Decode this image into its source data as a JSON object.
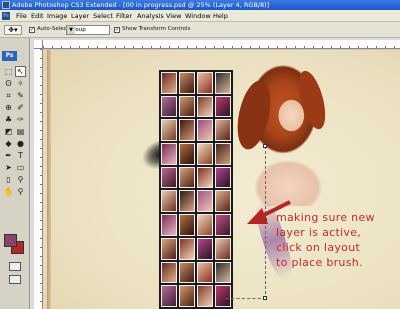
{
  "window": {
    "title": "Adobe Photoshop CS3 Extended - [00 in progress.psd @ 25% (Layer 4, RGB/8)]"
  },
  "app_icon": "Ps",
  "menu": [
    "File",
    "Edit",
    "Image",
    "Layer",
    "Select",
    "Filter",
    "Analysis",
    "View",
    "Window",
    "Help"
  ],
  "options_bar": {
    "auto_select_label": "Auto-Select:",
    "auto_select_checked": true,
    "auto_select_value": "Group",
    "show_transform_label": "Show Transform Controls",
    "show_transform_checked": true
  },
  "toolbox": {
    "logo": "Ps",
    "foreground_color": "#86446a",
    "background_color": "#b32727"
  },
  "annotation": {
    "lines": [
      "making sure new",
      "layer is active,",
      "click on layout",
      "to place brush."
    ],
    "color": "#c22a2a"
  }
}
